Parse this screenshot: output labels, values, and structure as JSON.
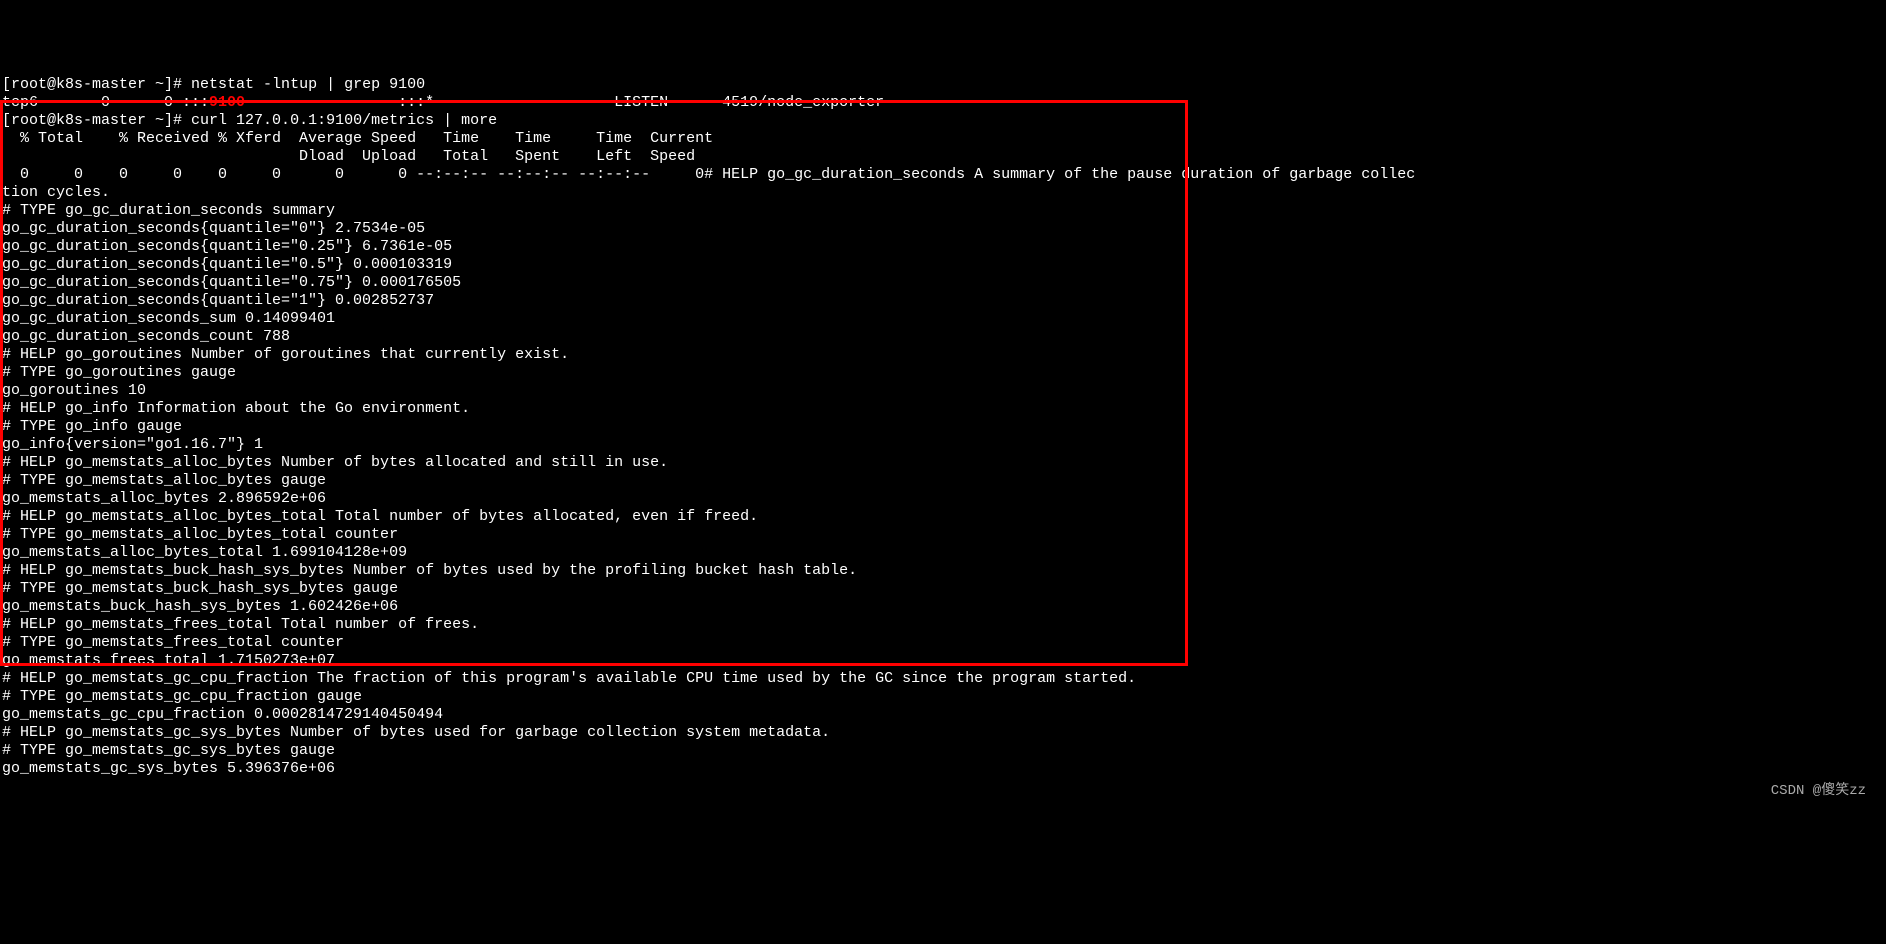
{
  "prompt_user": "[root@k8s-master ~]#",
  "cmd1": "netstat -lntup | grep 9100",
  "netstat_line_pre": "tcp6       0      0 :::",
  "netstat_port": "9100",
  "netstat_line_post": "                 :::*                    LISTEN      4519/node_exporter",
  "cmd2": "curl 127.0.0.1:9100/metrics | more",
  "curl_header1": "  % Total    % Received % Xferd  Average Speed   Time    Time     Time  Current",
  "curl_header2": "                                 Dload  Upload   Total   Spent    Left  Speed",
  "curl_progress": "  0     0    0     0    0     0      0      0 --:--:-- --:--:-- --:--:--     0# HELP go_gc_duration_seconds A summary of the pause duration of garbage collec",
  "metrics": [
    "tion cycles.",
    "# TYPE go_gc_duration_seconds summary",
    "go_gc_duration_seconds{quantile=\"0\"} 2.7534e-05",
    "go_gc_duration_seconds{quantile=\"0.25\"} 6.7361e-05",
    "go_gc_duration_seconds{quantile=\"0.5\"} 0.000103319",
    "go_gc_duration_seconds{quantile=\"0.75\"} 0.000176505",
    "go_gc_duration_seconds{quantile=\"1\"} 0.002852737",
    "go_gc_duration_seconds_sum 0.14099401",
    "go_gc_duration_seconds_count 788",
    "# HELP go_goroutines Number of goroutines that currently exist.",
    "# TYPE go_goroutines gauge",
    "go_goroutines 10",
    "# HELP go_info Information about the Go environment.",
    "# TYPE go_info gauge",
    "go_info{version=\"go1.16.7\"} 1",
    "# HELP go_memstats_alloc_bytes Number of bytes allocated and still in use.",
    "# TYPE go_memstats_alloc_bytes gauge",
    "go_memstats_alloc_bytes 2.896592e+06",
    "# HELP go_memstats_alloc_bytes_total Total number of bytes allocated, even if freed.",
    "# TYPE go_memstats_alloc_bytes_total counter",
    "go_memstats_alloc_bytes_total 1.699104128e+09",
    "# HELP go_memstats_buck_hash_sys_bytes Number of bytes used by the profiling bucket hash table.",
    "# TYPE go_memstats_buck_hash_sys_bytes gauge",
    "go_memstats_buck_hash_sys_bytes 1.602426e+06",
    "# HELP go_memstats_frees_total Total number of frees.",
    "# TYPE go_memstats_frees_total counter",
    "go_memstats_frees_total 1.7150273e+07",
    "# HELP go_memstats_gc_cpu_fraction The fraction of this program's available CPU time used by the GC since the program started.",
    "# TYPE go_memstats_gc_cpu_fraction gauge",
    "go_memstats_gc_cpu_fraction 0.0002814729140450494",
    "# HELP go_memstats_gc_sys_bytes Number of bytes used for garbage collection system metadata.",
    "# TYPE go_memstats_gc_sys_bytes gauge",
    "go_memstats_gc_sys_bytes 5.396376e+06"
  ],
  "watermark": "CSDN @傻笑zz"
}
